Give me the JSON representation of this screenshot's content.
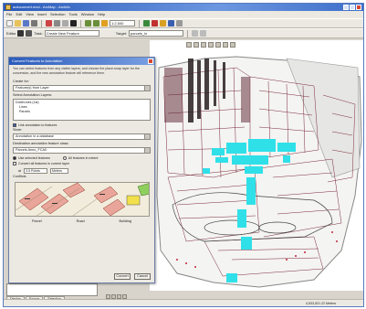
{
  "window": {
    "title": "autoconvert.mxd - ArcMap - ArcInfo"
  },
  "menu": [
    "File",
    "Edit",
    "View",
    "Insert",
    "Selection",
    "Tools",
    "Window",
    "Help"
  ],
  "toolbar": {
    "scale": "1:2,500",
    "task_label": "Task:",
    "task_value": "Create New Feature",
    "target_label": "Target:",
    "target_value": "parcels_ln",
    "editor_label": "Editor"
  },
  "dialog": {
    "title": "Convert Features to Annotation",
    "intro": "You can select features from any visible layers, and choose the place-snap layer for the conversion, and the new annotation feature will reference them.",
    "feature_class_label": "Create for:",
    "feature_class_value": "Feature(s) from Layer",
    "layers_label": "Select Annotation Layers:",
    "layers": [
      "Draft/Lines (1st)",
      "Lines",
      "Parcels"
    ],
    "check_related_label": "Link annotation to features",
    "store_label": "Store:",
    "store_value": "Annotation in a database",
    "destination_label": "Destination annotation feature class:",
    "destination_value": "Parcels Anno_FCAll",
    "opt_selected": "Use selected features",
    "opt_current_extent": "All features in extent",
    "opt_all": "Convert all features in current layer",
    "tolerance_label": "at",
    "tolerance_value": "3.5 Points",
    "tolerance_units": "Meters",
    "notes_label": "Conflicts",
    "preview_captions": [
      "Parcel",
      "Road",
      "Building"
    ],
    "ok_label": "Convert",
    "cancel_label": "Cancel"
  },
  "lower_tabs": [
    "Display",
    "Source",
    "Selection"
  ],
  "status": {
    "coords": "4,533,521.22 Meters"
  }
}
